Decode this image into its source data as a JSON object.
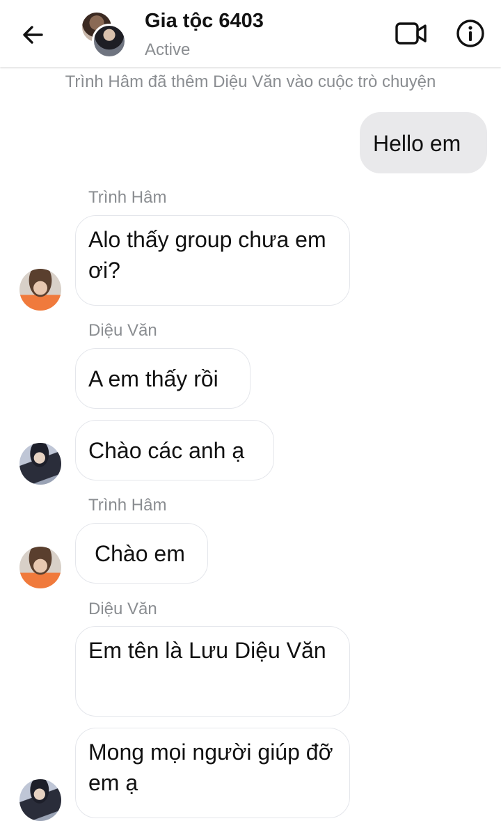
{
  "header": {
    "title": "Gia tộc 6403",
    "status": "Active"
  },
  "system_note": "Trình Hâm đã thêm Diệu Văn vào cuộc trò chuyện",
  "messages": [
    {
      "type": "outgoing",
      "text": "Hello em"
    },
    {
      "sender": "Trình Hâm",
      "text": "Alo thấy group chưa em ơi?"
    },
    {
      "sender": "Diệu Văn",
      "text": "A em thấy rồi"
    },
    {
      "text": "Chào các anh ạ"
    },
    {
      "sender": "Trình Hâm",
      "text": "Chào em"
    },
    {
      "sender": "Diệu Văn",
      "text": "Em tên là Lưu Diệu Văn"
    },
    {
      "text": "Mong mọi người giúp đỡ em ạ"
    }
  ],
  "icons": {
    "back": "arrow-left-icon",
    "video": "video-camera-icon",
    "info": "info-icon"
  },
  "colors": {
    "outgoing_bubble": "#e9e9eb",
    "incoming_border": "#e4e6eb",
    "meta_text": "#8a8d91"
  }
}
